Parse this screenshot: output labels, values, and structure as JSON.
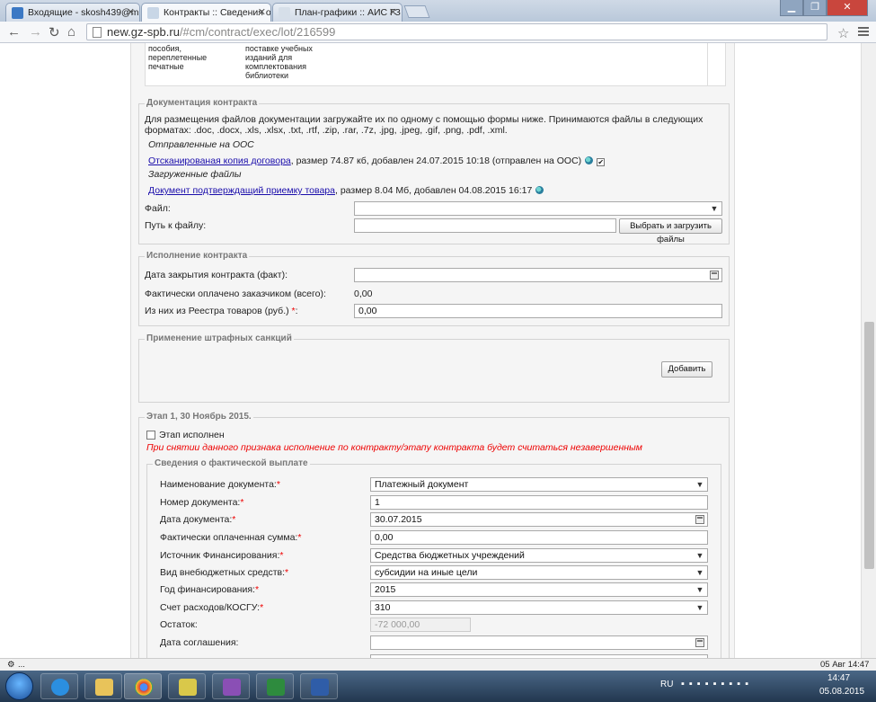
{
  "browser": {
    "tabs": [
      {
        "title": "Входящие - skosh439@m",
        "active": false
      },
      {
        "title": "Контракты :: Сведения о",
        "active": true
      },
      {
        "title": "План-графики :: АИС ГЗ",
        "active": false
      }
    ],
    "url_host": "new.gz-spb.ru",
    "url_path": "/#cm/contract/exec/lot/216599"
  },
  "top_table": {
    "cell1": "пособия, переплетенные печатные",
    "cell2": "поставке учебных изданий для комплектования библиотеки"
  },
  "docs": {
    "legend": "Документация контракта",
    "info": "Для размещения файлов документации загружайте их по одному с помощью формы ниже. Принимаются файлы в следующих форматах: .doc, .docx, .xls, .xlsx, .txt, .rtf, .zip, .rar, .7z, .jpg, .jpeg, .gif, .png, .pdf, .xml.",
    "sent_heading": "Отправленные на ООС",
    "sent_link": "Отсканированая копия договора",
    "sent_meta": ", размер 74.87 кб, добавлен 24.07.2015 10:18 (отправлен на ООС)",
    "loaded_heading": "Загруженные файлы",
    "loaded_link": "Документ подтверждащий приемку товара",
    "loaded_meta": ", размер 8.04 Мб, добавлен 04.08.2015 16:17",
    "file_label": "Файл:",
    "path_label": "Путь к файлу:",
    "upload_button": "Выбрать и загрузить файлы"
  },
  "execution": {
    "legend": "Исполнение контракта",
    "close_date_label": "Дата закрытия контракта (факт):",
    "close_date_value": "",
    "paid_label": "Фактически оплачено заказчиком (всего):",
    "paid_value": "0,00",
    "registry_label": "Из них из Реестра товаров (руб.) ",
    "registry_value": "0,00"
  },
  "penalties": {
    "legend": "Применение штрафных санкций",
    "add_button": "Добавить"
  },
  "stage": {
    "legend": "Этап 1, 30 Ноябрь 2015.",
    "done_label": "Этап исполнен",
    "done_checked": false,
    "warning": "При снятии данного признака исполнение по контракту/этапу контракта будет считаться незавершенным",
    "payment": {
      "legend": "Сведения о фактической выплате",
      "doc_name_label": "Наименование документа:",
      "doc_name_value": "Платежный документ",
      "doc_number_label": "Номер документа:",
      "doc_number_value": "1",
      "doc_date_label": "Дата документа:",
      "doc_date_value": "30.07.2015",
      "paid_sum_label": "Фактически оплаченная сумма:",
      "paid_sum_value": "0,00",
      "source_label": "Источник Финансирования:",
      "source_value": "Средства бюджетных учреждений",
      "offbudget_label": "Вид внебюджетных средств:",
      "offbudget_value": "субсидии на иные цели",
      "year_label": "Год финансирования:",
      "year_value": "2015",
      "account_label": "Счет расходов/КОСГУ:",
      "account_value": "310",
      "remainder_label": "Остаток:",
      "remainder_value": "-72 000,00",
      "agreement_date_label": "Дата соглашения:",
      "agreement_date_value": ""
    }
  },
  "required_mark": "*",
  "status": {
    "left": "...",
    "right": "05 Авг 14:47"
  },
  "taskbar": {
    "lang": "RU",
    "time": "14:47",
    "date": "05.08.2015"
  }
}
